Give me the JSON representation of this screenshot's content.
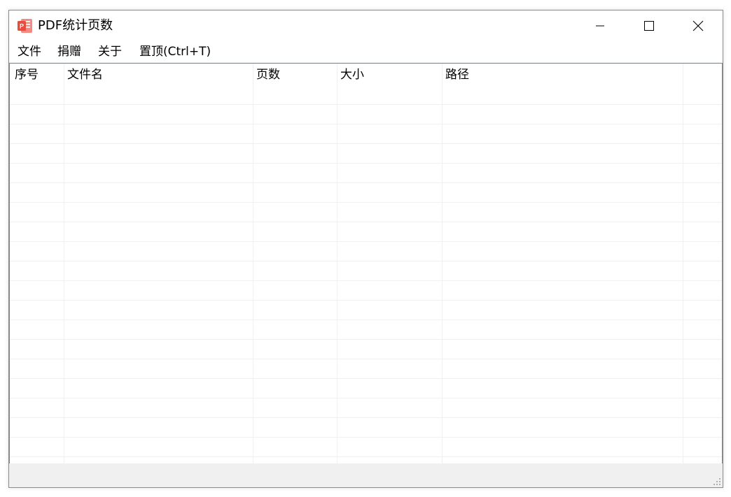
{
  "window": {
    "title": "PDF统计页数",
    "controls": {
      "minimize_icon": "minimize-icon",
      "maximize_icon": "maximize-icon",
      "close_icon": "close-icon"
    }
  },
  "menu": {
    "items": [
      {
        "label": "文件"
      },
      {
        "label": "捐赠"
      },
      {
        "label": "关于"
      },
      {
        "label": "置顶(Ctrl+T)"
      }
    ]
  },
  "table": {
    "columns": [
      {
        "label": "序号"
      },
      {
        "label": "文件名"
      },
      {
        "label": "页数"
      },
      {
        "label": "大小"
      },
      {
        "label": "路径"
      }
    ],
    "rows": []
  },
  "colors": {
    "app_icon_red": "#e84c3d",
    "grid_line": "#f0f0f0",
    "border": "#828790",
    "chrome_bg": "#f0f0f0"
  }
}
